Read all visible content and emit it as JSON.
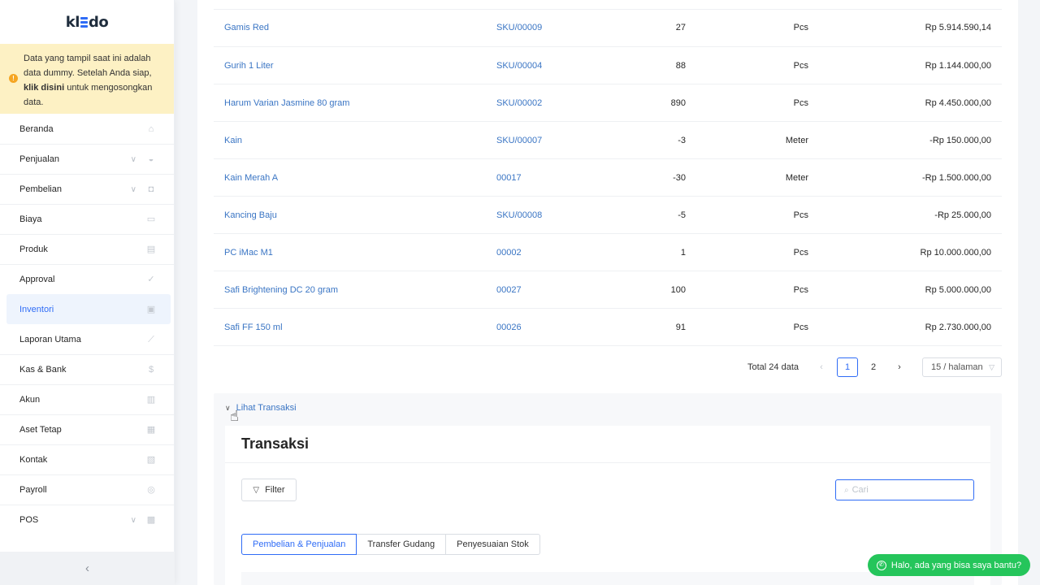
{
  "app": {
    "logo": "kledo"
  },
  "notice": {
    "text_before": "Data yang tampil saat ini adalah data dummy. Setelah Anda siap, ",
    "link": "klik disini",
    "text_after": " untuk mengosongkan data."
  },
  "sidebar": {
    "items": [
      {
        "label": "Beranda",
        "icon": "home-icon",
        "chevron": false
      },
      {
        "label": "Penjualan",
        "icon": "basket-icon",
        "chevron": true
      },
      {
        "label": "Pembelian",
        "icon": "bag-icon",
        "chevron": true
      },
      {
        "label": "Biaya",
        "icon": "card-icon",
        "chevron": false
      },
      {
        "label": "Produk",
        "icon": "box-icon",
        "chevron": false
      },
      {
        "label": "Approval",
        "icon": "check-icon",
        "chevron": false
      },
      {
        "label": "Inventori",
        "icon": "inventory-icon",
        "chevron": false,
        "active": true
      },
      {
        "label": "Laporan Utama",
        "icon": "chart-icon",
        "chevron": false
      },
      {
        "label": "Kas & Bank",
        "icon": "dollar-icon",
        "chevron": false
      },
      {
        "label": "Akun",
        "icon": "ledger-icon",
        "chevron": false
      },
      {
        "label": "Aset Tetap",
        "icon": "building-icon",
        "chevron": false
      },
      {
        "label": "Kontak",
        "icon": "contact-card-icon",
        "chevron": false
      },
      {
        "label": "Payroll",
        "icon": "payroll-icon",
        "chevron": false
      },
      {
        "label": "POS",
        "icon": "pos-icon",
        "chevron": true
      }
    ],
    "collapse": "‹"
  },
  "products": [
    {
      "name": "Gamis Red",
      "sku": "SKU/00009",
      "qty": "27",
      "unit": "Pcs",
      "value": "Rp 5.914.590,14"
    },
    {
      "name": "Gurih 1 Liter",
      "sku": "SKU/00004",
      "qty": "88",
      "unit": "Pcs",
      "value": "Rp 1.144.000,00"
    },
    {
      "name": "Harum Varian Jasmine 80 gram",
      "sku": "SKU/00002",
      "qty": "890",
      "unit": "Pcs",
      "value": "Rp 4.450.000,00"
    },
    {
      "name": "Kain",
      "sku": "SKU/00007",
      "qty": "-3",
      "unit": "Meter",
      "value": "-Rp 150.000,00"
    },
    {
      "name": "Kain Merah A",
      "sku": "00017",
      "qty": "-30",
      "unit": "Meter",
      "value": "-Rp 1.500.000,00"
    },
    {
      "name": "Kancing Baju",
      "sku": "SKU/00008",
      "qty": "-5",
      "unit": "Pcs",
      "value": "-Rp 25.000,00"
    },
    {
      "name": "PC iMac M1",
      "sku": "00002",
      "qty": "1",
      "unit": "Pcs",
      "value": "Rp 10.000.000,00"
    },
    {
      "name": "Safi Brightening DC 20 gram",
      "sku": "00027",
      "qty": "100",
      "unit": "Pcs",
      "value": "Rp 5.000.000,00"
    },
    {
      "name": "Safi FF 150 ml",
      "sku": "00026",
      "qty": "91",
      "unit": "Pcs",
      "value": "Rp 2.730.000,00"
    }
  ],
  "pagination": {
    "total": "Total 24 data",
    "prev": "‹",
    "pages": [
      "1",
      "2"
    ],
    "current": "1",
    "next": "›",
    "page_size": "15 / halaman"
  },
  "transactions": {
    "toggle": "Lihat Transaksi",
    "title": "Transaksi",
    "filter": "Filter",
    "search_placeholder": "Cari",
    "tabs": [
      "Pembelian & Penjualan",
      "Transfer Gudang",
      "Penyesuaian Stok"
    ],
    "active_tab": 0
  },
  "whatsapp": {
    "label": "Halo, ada yang bisa saya bantu?"
  },
  "colors": {
    "accent": "#2f6cf6",
    "link": "#3a75c4",
    "notice_bg": "#fdf1c4",
    "whatsapp": "#25c55b"
  }
}
